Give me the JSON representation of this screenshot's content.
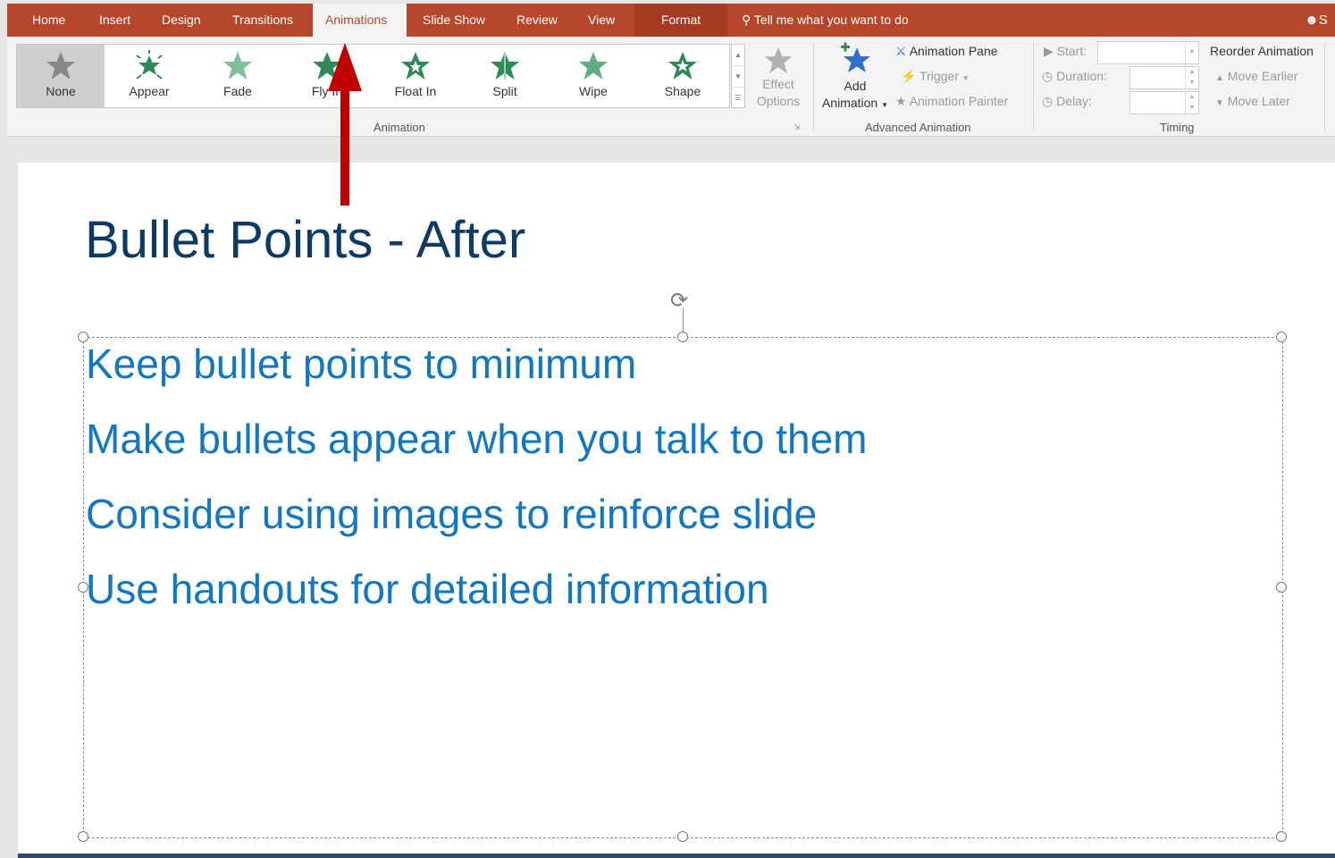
{
  "tabs": [
    {
      "label": "Home"
    },
    {
      "label": "Insert"
    },
    {
      "label": "Design"
    },
    {
      "label": "Transitions"
    },
    {
      "label": "Animations"
    },
    {
      "label": "Slide Show"
    },
    {
      "label": "Review"
    },
    {
      "label": "View"
    },
    {
      "label": "Format"
    }
  ],
  "tell_me": "Tell me what you want to do",
  "share_partial": "S",
  "gallery": {
    "items": [
      {
        "label": "None"
      },
      {
        "label": "Appear"
      },
      {
        "label": "Fade"
      },
      {
        "label": "Fly In"
      },
      {
        "label": "Float In"
      },
      {
        "label": "Split"
      },
      {
        "label": "Wipe"
      },
      {
        "label": "Shape"
      }
    ],
    "group_label": "Animation",
    "selected": "None"
  },
  "effect_options": {
    "line1": "Effect",
    "line2": "Options"
  },
  "advanced": {
    "add_line1": "Add",
    "add_line2": "Animation",
    "pane": "Animation Pane",
    "trigger": "Trigger",
    "painter": "Animation Painter",
    "group_label": "Advanced Animation"
  },
  "timing": {
    "start": "Start:",
    "duration": "Duration:",
    "delay": "Delay:",
    "group_label": "Timing"
  },
  "reorder": {
    "title": "Reorder Animation",
    "earlier": "Move Earlier",
    "later": "Move Later"
  },
  "slide": {
    "title": "Bullet Points - After",
    "bullets": [
      "Keep bullet points to minimum",
      "Make bullets appear when you talk to them",
      "Consider using images to reinforce slide",
      "Use handouts for detailed information"
    ]
  },
  "colors": {
    "ribbon_tab": "#b7472a",
    "title": "#0d3b66",
    "bullet": "#1177c2",
    "arrow": "#c00000"
  }
}
